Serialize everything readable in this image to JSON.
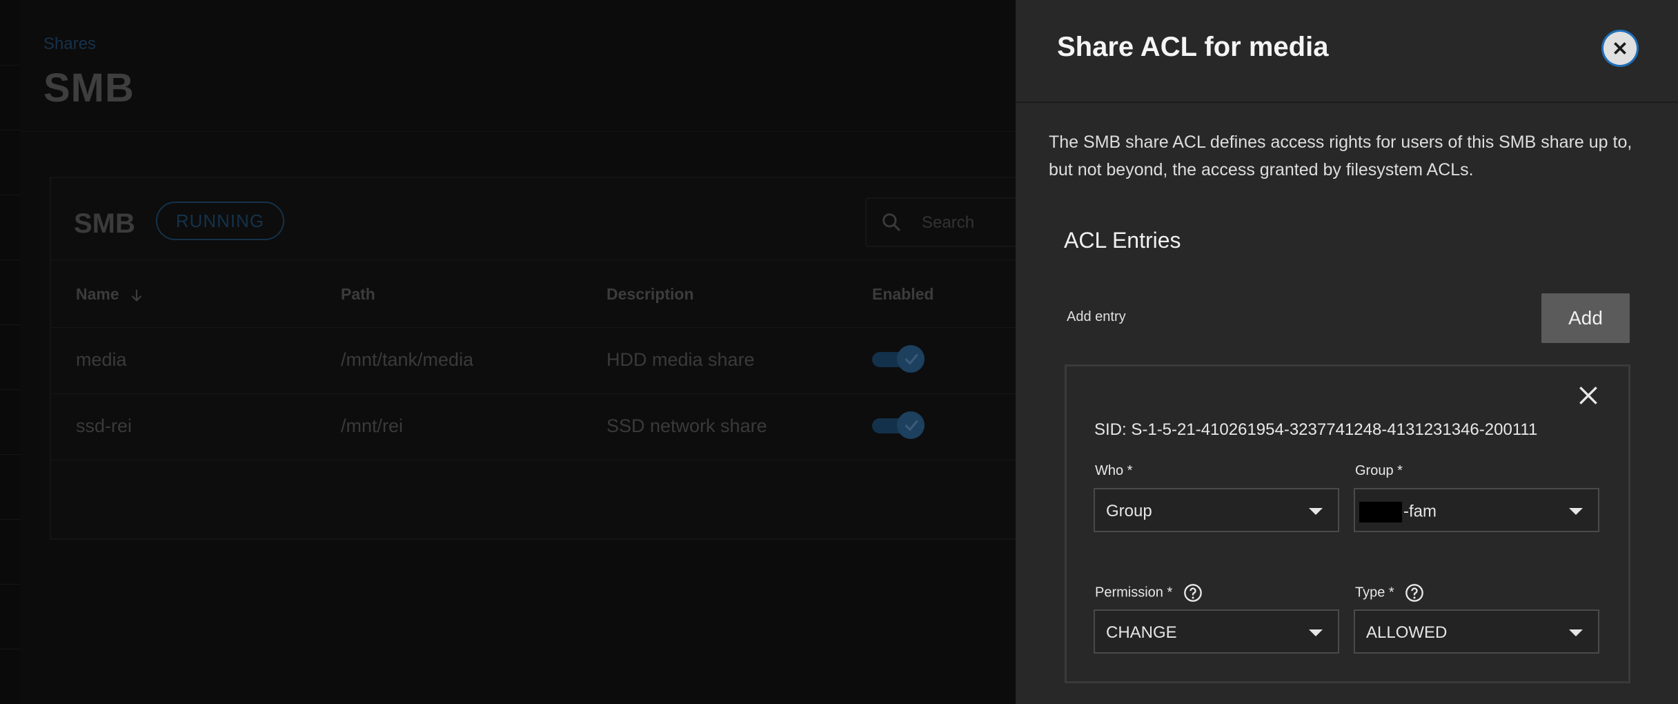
{
  "background": {
    "breadcrumb": "Shares",
    "page_title": "SMB",
    "card": {
      "title": "SMB",
      "status": "RUNNING",
      "search_placeholder": "Search"
    },
    "table": {
      "columns": [
        "Name",
        "Path",
        "Description",
        "Enabled"
      ],
      "rows": [
        {
          "name": "media",
          "path": "/mnt/tank/media",
          "description": "HDD media share",
          "enabled": true
        },
        {
          "name": "ssd-rei",
          "path": "/mnt/rei",
          "description": "SSD network share",
          "enabled": true
        }
      ]
    }
  },
  "panel": {
    "title": "Share ACL for media",
    "description": "The SMB share ACL defines access rights for users of this SMB share up to, but not beyond, the access granted by filesystem ACLs.",
    "section_title": "ACL Entries",
    "add_entry_label": "Add entry",
    "add_button": "Add",
    "entry": {
      "sid": "SID: S-1-5-21-410261954-3237741248-4131231346-200111",
      "who_label": "Who *",
      "who_value": "Group",
      "group_label": "Group *",
      "group_value_suffix": "-fam",
      "permission_label": "Permission *",
      "permission_value": "CHANGE",
      "type_label": "Type *",
      "type_value": "ALLOWED"
    }
  },
  "colors": {
    "panel_bg": "#282828",
    "accent_blue": "#1e6fb8",
    "add_button_bg": "#5b5b5b"
  }
}
